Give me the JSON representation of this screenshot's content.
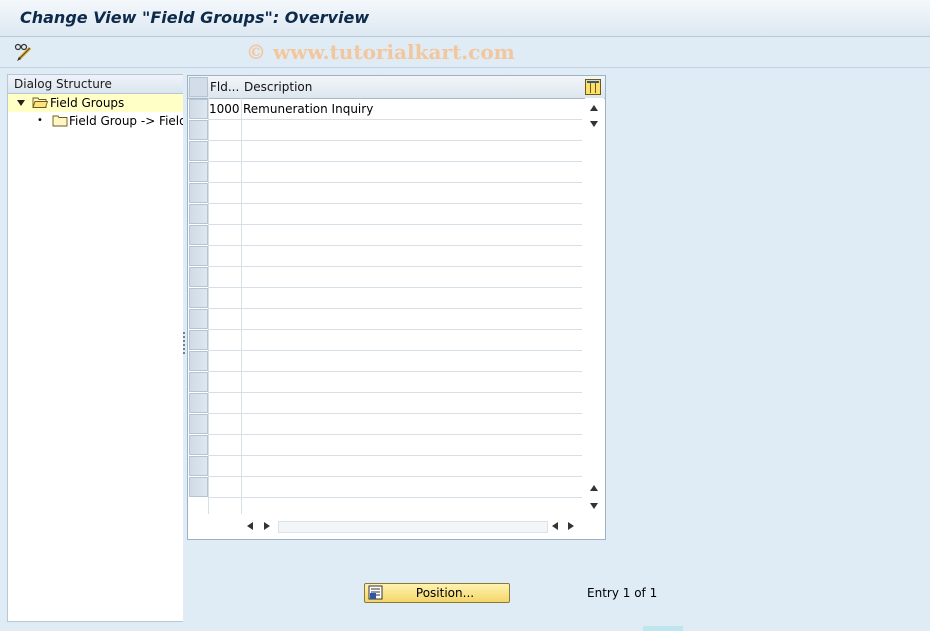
{
  "window": {
    "title": "Change View \"Field Groups\": Overview"
  },
  "toolbar": {
    "edit_icon": "pencil-glasses-icon"
  },
  "watermark": "© www.tutorialkart.com",
  "dialog_structure": {
    "header": "Dialog Structure",
    "items": [
      {
        "label": "Field Groups",
        "icon": "folder-open-icon",
        "selected": true,
        "expanded": true
      },
      {
        "label": "Field Group -> Fields",
        "icon": "folder-icon",
        "selected": false
      }
    ]
  },
  "table": {
    "columns": [
      "Fld...",
      "Description"
    ],
    "rows": [
      {
        "fld": "1000",
        "description": "Remuneration Inquiry"
      }
    ],
    "visible_row_count": 19,
    "settings_icon": "table-settings-icon"
  },
  "footer": {
    "position_button": "Position...",
    "entry_text": "Entry 1 of 1"
  }
}
